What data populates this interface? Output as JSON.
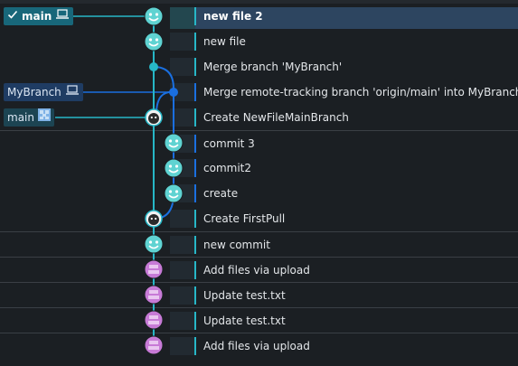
{
  "branch_tags": {
    "head": {
      "label": "main",
      "check_icon": "check-icon",
      "location_icon": "laptop-icon"
    },
    "mybranch": {
      "label": "MyBranch",
      "location_icon": "laptop-icon"
    },
    "remote_main": {
      "label": "main",
      "location_icon": "remote-avatar-icon"
    }
  },
  "colors": {
    "lane_main": "#27b7c7",
    "lane_branch": "#1a6fe0",
    "avatar_main": "#5fd3d2",
    "avatar_upload": "#c77ad6",
    "separator": "#3a3f45",
    "selected_row": "#2d4560"
  },
  "commits": [
    {
      "message": "new file 2",
      "avatar": "teal-smiley-avatar",
      "lane": "main",
      "selected": true
    },
    {
      "message": "new file",
      "avatar": "teal-smiley-avatar",
      "lane": "main"
    },
    {
      "message": "Merge branch 'MyBranch'",
      "avatar": "merge-dot",
      "lane": "main"
    },
    {
      "message": "Merge remote-tracking branch 'origin/main' into MyBranch",
      "avatar": "merge-dot",
      "lane": "branch"
    },
    {
      "message": "Create NewFileMainBranch",
      "avatar": "dark-face-avatar",
      "lane": "main"
    },
    {
      "message": "commit 3",
      "avatar": "teal-smiley-avatar",
      "lane": "branch"
    },
    {
      "message": "commit2",
      "avatar": "teal-smiley-avatar",
      "lane": "branch"
    },
    {
      "message": "create",
      "avatar": "teal-smiley-avatar",
      "lane": "branch"
    },
    {
      "message": "Create FirstPull",
      "avatar": "dark-face-avatar",
      "lane": "main"
    },
    {
      "message": "new commit",
      "avatar": "teal-smiley-avatar",
      "lane": "main"
    },
    {
      "message": "Add files via upload",
      "avatar": "purple-avatar",
      "lane": "main"
    },
    {
      "message": "Update test.txt",
      "avatar": "purple-avatar",
      "lane": "main"
    },
    {
      "message": "Update test.txt",
      "avatar": "purple-avatar",
      "lane": "main"
    },
    {
      "message": "Add files via upload",
      "avatar": "purple-avatar",
      "lane": "main"
    }
  ]
}
